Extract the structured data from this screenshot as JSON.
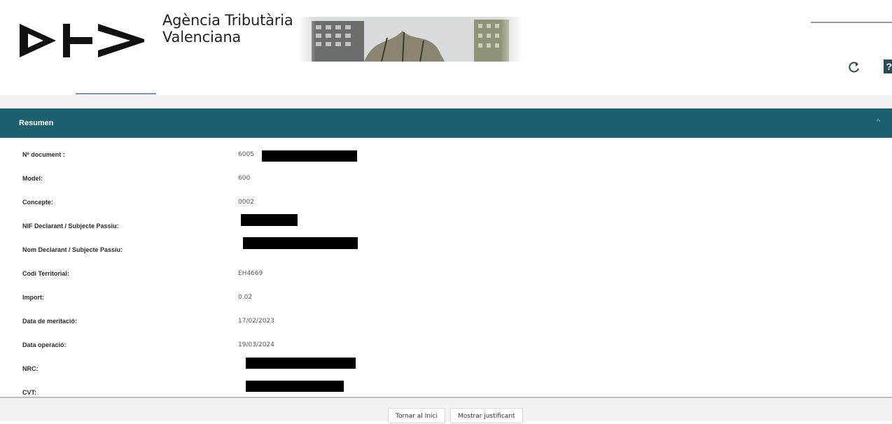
{
  "header": {
    "agency_line1": "Agència Tributària",
    "agency_line2": "Valenciana"
  },
  "panel": {
    "title": "Resumen",
    "rows": [
      {
        "label": "Nº document :",
        "value": "6005",
        "redacted": true
      },
      {
        "label": "Model:",
        "value": "600",
        "redacted": false
      },
      {
        "label": "Concepte:",
        "value": "0002",
        "redacted": false
      },
      {
        "label": "NIF Declarant / Subjecte Passiu:",
        "value": "",
        "redacted": true
      },
      {
        "label": "Nom Declarant / Subjecte Passiu:",
        "value": "",
        "redacted": true
      },
      {
        "label": "Codi Territorial:",
        "value": "EH4669",
        "redacted": false
      },
      {
        "label": "Import:",
        "value": "0.02",
        "redacted": false
      },
      {
        "label": "Data de meritació:",
        "value": "17/02/2023",
        "redacted": false
      },
      {
        "label": "Data operació:",
        "value": "19/03/2024",
        "redacted": false
      },
      {
        "label": "NRC:",
        "value": "",
        "redacted": true
      },
      {
        "label": "CVT:",
        "value": "",
        "redacted": true
      }
    ]
  },
  "footer": {
    "home_button": "Tornar al Inici",
    "receipt_button": "Mostrar justificant"
  },
  "icons": {
    "refresh": "refresh-icon",
    "help": "help-icon",
    "collapse": "chevron-up-icon"
  },
  "colors": {
    "panel_header": "#1c5f6f",
    "tab_indicator": "#7c8fc7"
  }
}
